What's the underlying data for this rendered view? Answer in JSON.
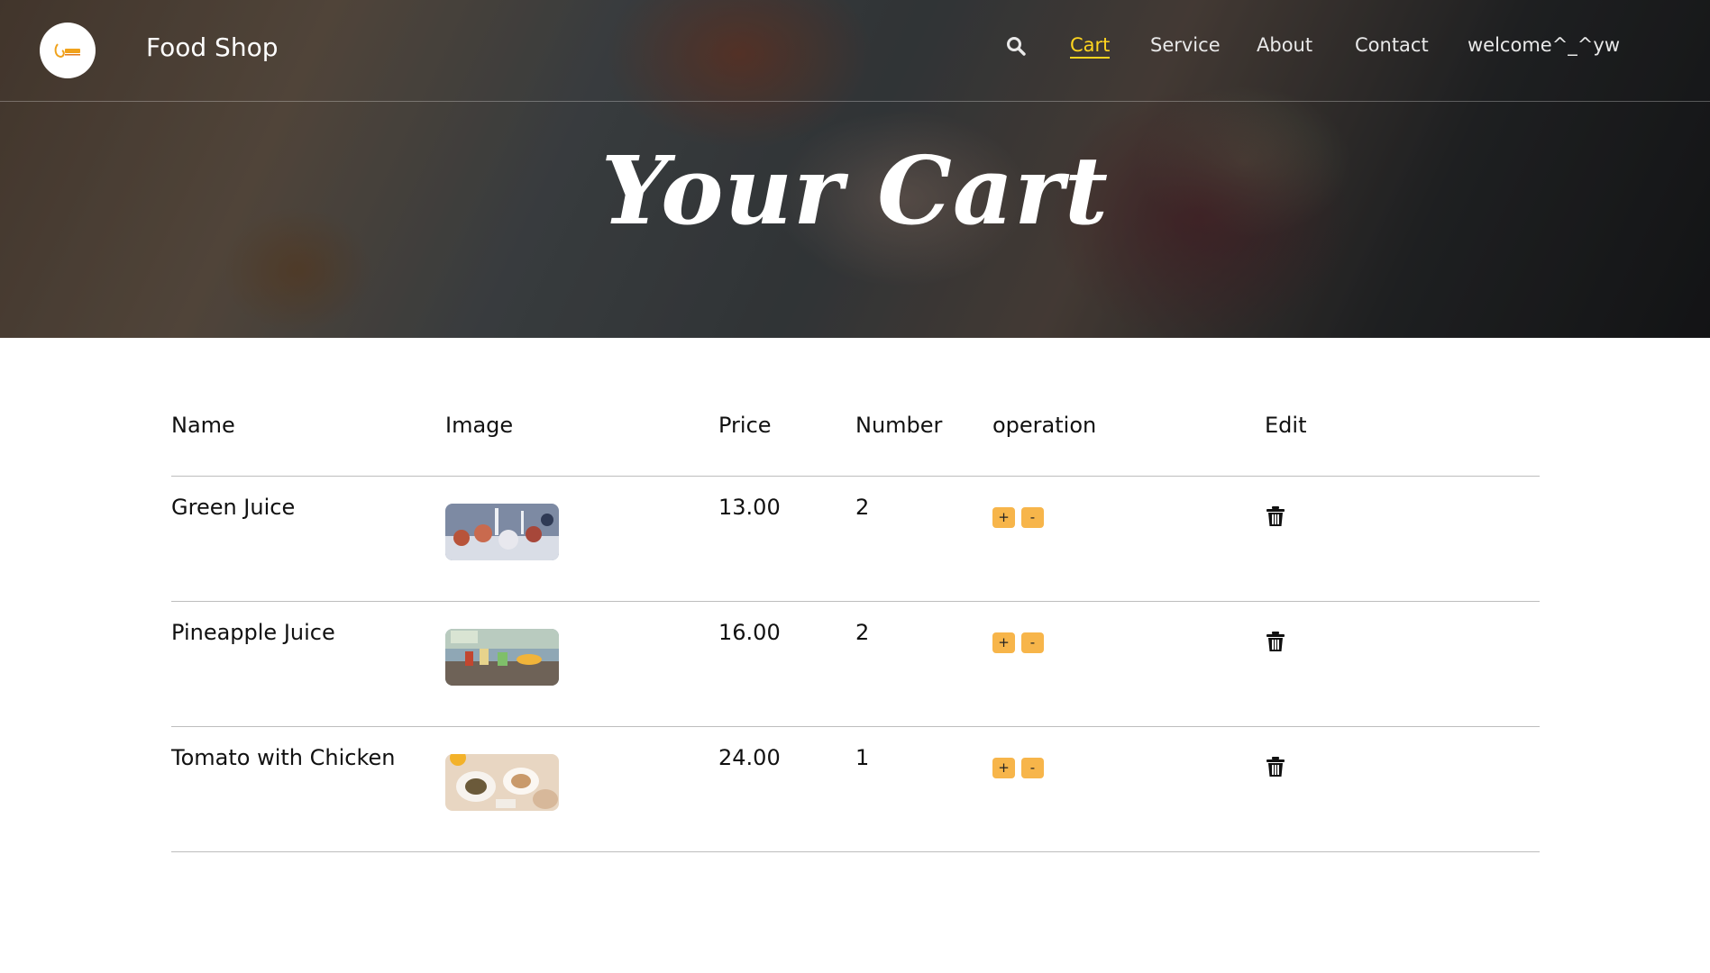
{
  "header": {
    "brand": "Food Shop",
    "logo_icon": "food-shop-logo-icon",
    "search_icon": "search-icon",
    "nav": [
      {
        "label": "Cart",
        "active": true
      },
      {
        "label": "Service",
        "active": false
      },
      {
        "label": "About",
        "active": false
      },
      {
        "label": "Contact",
        "active": false
      },
      {
        "label": "welcome^_^yw",
        "active": false
      }
    ],
    "active_color": "#ffd51f"
  },
  "hero": {
    "title": "Your Cart"
  },
  "cart": {
    "columns": [
      "Name",
      "Image",
      "Price",
      "Number",
      "operation",
      "Edit"
    ],
    "items": [
      {
        "name": "Green Juice",
        "price": "13.00",
        "number": "2"
      },
      {
        "name": "Pineapple Juice",
        "price": "16.00",
        "number": "2"
      },
      {
        "name": "Tomato with Chicken",
        "price": "24.00",
        "number": "1"
      }
    ],
    "increase_label": "+",
    "decrease_label": "-",
    "delete_icon": "trash-icon",
    "button_color": "#f7b54a"
  }
}
